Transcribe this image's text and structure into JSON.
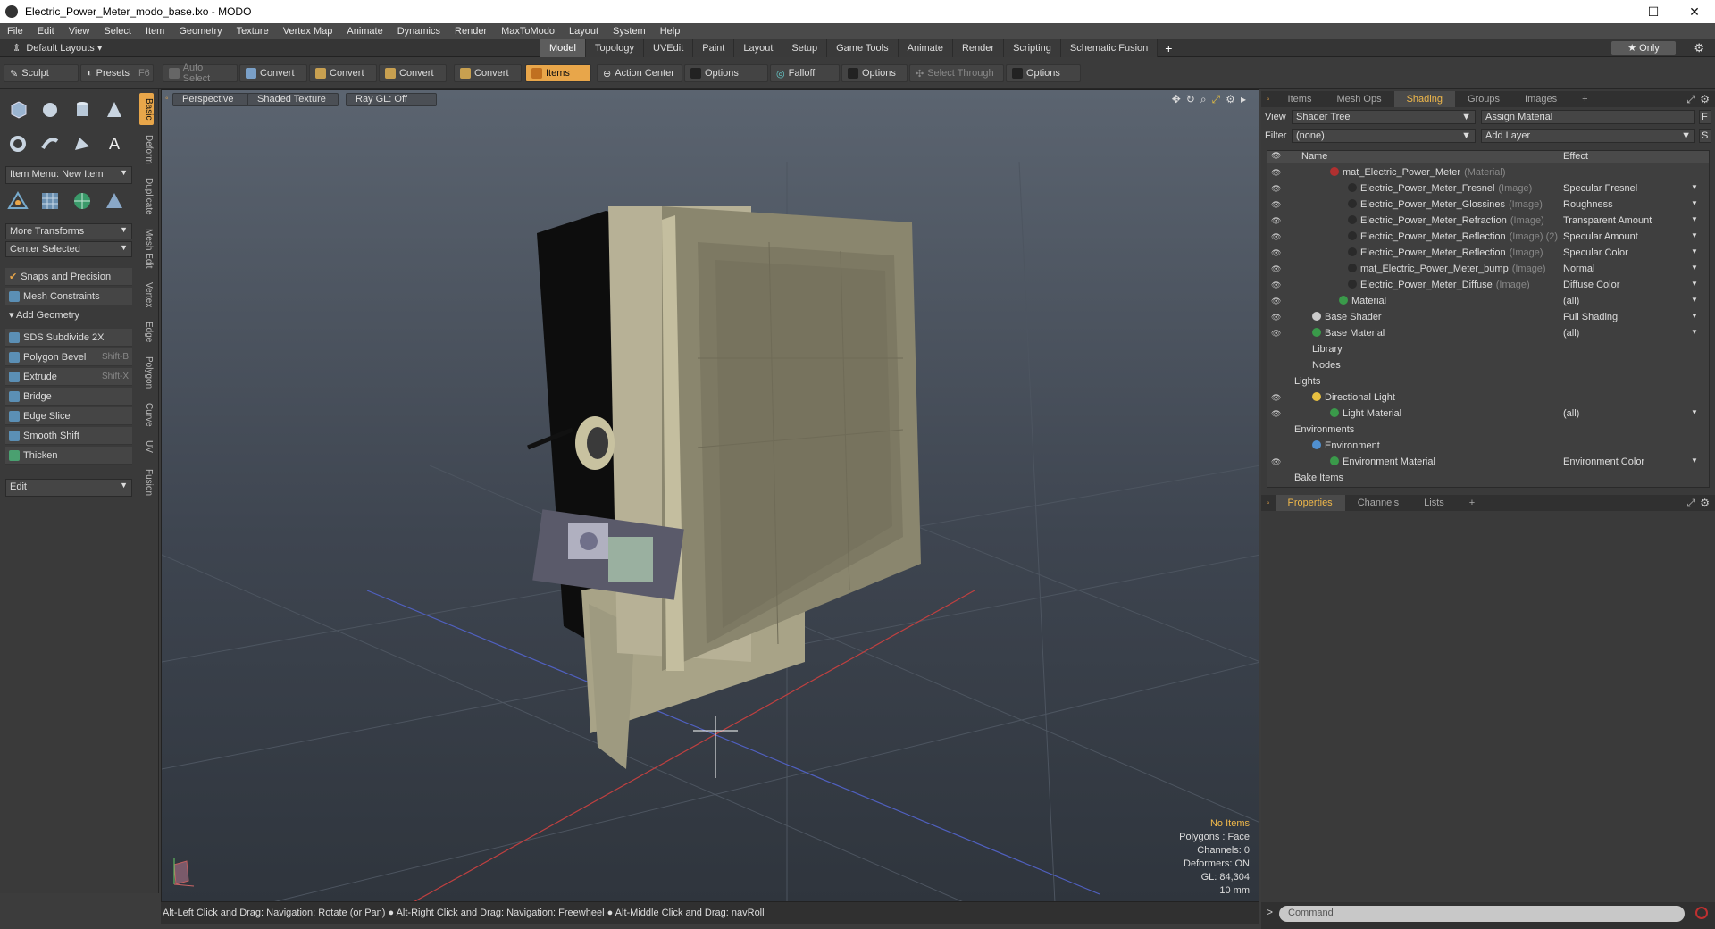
{
  "title": "Electric_Power_Meter_modo_base.lxo - MODO",
  "window_buttons": [
    "—",
    "☐",
    "✕"
  ],
  "menu": [
    "File",
    "Edit",
    "View",
    "Select",
    "Item",
    "Geometry",
    "Texture",
    "Vertex Map",
    "Animate",
    "Dynamics",
    "Render",
    "MaxToModo",
    "Layout",
    "System",
    "Help"
  ],
  "layout_selector": "Default Layouts",
  "layout_tabs": [
    "Model",
    "Topology",
    "UVEdit",
    "Paint",
    "Layout",
    "Setup",
    "Game Tools",
    "Animate",
    "Render",
    "Scripting",
    "Schematic Fusion"
  ],
  "active_layout_tab": "Model",
  "only_label": "Only",
  "toolbar": {
    "sculpt": "Sculpt",
    "presets": "Presets",
    "presets_key": "F6",
    "auto_select": "Auto Select",
    "convert1": "Convert",
    "convert2": "Convert",
    "convert3": "Convert",
    "convert4": "Convert",
    "items": "Items",
    "action_center": "Action Center",
    "options1": "Options",
    "falloff": "Falloff",
    "options2": "Options",
    "select_through": "Select Through",
    "options3": "Options"
  },
  "left": {
    "item_menu": "Item Menu: New Item",
    "more_transforms": "More Transforms",
    "center_selected": "Center Selected",
    "snaps": "Snaps and Precision",
    "mesh_constraints": "Mesh Constraints",
    "add_geometry": "Add Geometry",
    "tools": [
      {
        "label": "SDS Subdivide 2X",
        "key": ""
      },
      {
        "label": "Polygon Bevel",
        "key": "Shift-B"
      },
      {
        "label": "Extrude",
        "key": "Shift-X"
      },
      {
        "label": "Bridge",
        "key": ""
      },
      {
        "label": "Edge Slice",
        "key": ""
      },
      {
        "label": "Smooth Shift",
        "key": ""
      },
      {
        "label": "Thicken",
        "key": ""
      }
    ],
    "edit": "Edit",
    "vtabs": [
      "Basic",
      "Deform",
      "Duplicate",
      "Mesh Edit",
      "Vertex",
      "Edge",
      "Polygon",
      "Curve",
      "UV",
      "Fusion"
    ]
  },
  "viewport": {
    "perspective": "Perspective",
    "shading": "Shaded Texture",
    "raygl": "Ray GL: Off",
    "stats": {
      "no_items": "No Items",
      "polygons": "Polygons : Face",
      "channels": "Channels: 0",
      "deformers": "Deformers: ON",
      "gl": "GL: 84,304",
      "scale": "10 mm"
    }
  },
  "status_bar": "Alt-Left Click and Drag: Navigation: Rotate (or Pan) ● Alt-Right Click and Drag: Navigation: Freewheel ● Alt-Middle Click and Drag: navRoll",
  "right": {
    "tabs": [
      "Items",
      "Mesh Ops",
      "Shading",
      "Groups",
      "Images"
    ],
    "active_tab": "Shading",
    "view_label": "View",
    "view_value": "Shader Tree",
    "assign_material": "Assign Material",
    "filter_label": "Filter",
    "filter_value": "(none)",
    "add_layer": "Add Layer",
    "col_name": "Name",
    "col_effect": "Effect",
    "tree": [
      {
        "name": "mat_Electric_Power_Meter",
        "type": "(Material)",
        "effect": "",
        "indent": 5,
        "ball": "#b03030",
        "eye": true
      },
      {
        "name": "Electric_Power_Meter_Fresnel",
        "type": "(Image)",
        "effect": "Specular Fresnel",
        "indent": 7,
        "ball": "#2a2a2a",
        "eye": true
      },
      {
        "name": "Electric_Power_Meter_Glossines",
        "type": "(Image)",
        "effect": "Roughness",
        "indent": 7,
        "ball": "#2a2a2a",
        "eye": true
      },
      {
        "name": "Electric_Power_Meter_Refraction",
        "type": "(Image)",
        "effect": "Transparent Amount",
        "indent": 7,
        "ball": "#2a2a2a",
        "eye": true
      },
      {
        "name": "Electric_Power_Meter_Reflection",
        "type": "(Image) (2)",
        "effect": "Specular Amount",
        "indent": 7,
        "ball": "#2a2a2a",
        "eye": true
      },
      {
        "name": "Electric_Power_Meter_Reflection",
        "type": "(Image)",
        "effect": "Specular Color",
        "indent": 7,
        "ball": "#2a2a2a",
        "eye": true
      },
      {
        "name": "mat_Electric_Power_Meter_bump",
        "type": "(Image)",
        "effect": "Normal",
        "indent": 7,
        "ball": "#2a2a2a",
        "eye": true
      },
      {
        "name": "Electric_Power_Meter_Diffuse",
        "type": "(Image)",
        "effect": "Diffuse Color",
        "indent": 7,
        "ball": "#2a2a2a",
        "eye": true
      },
      {
        "name": "Material",
        "type": "",
        "effect": "(all)",
        "indent": 6,
        "ball": "#3a9a4a",
        "eye": true
      },
      {
        "name": "Base Shader",
        "type": "",
        "effect": "Full Shading",
        "indent": 3,
        "ball": "#cccccc",
        "eye": true
      },
      {
        "name": "Base Material",
        "type": "",
        "effect": "(all)",
        "indent": 3,
        "ball": "#3a9a4a",
        "eye": true
      },
      {
        "name": "Library",
        "type": "",
        "effect": "",
        "indent": 3,
        "ball": "",
        "eye": false
      },
      {
        "name": "Nodes",
        "type": "",
        "effect": "",
        "indent": 3,
        "ball": "",
        "eye": false
      },
      {
        "name": "Lights",
        "type": "",
        "effect": "",
        "indent": 1,
        "ball": "",
        "eye": false
      },
      {
        "name": "Directional Light",
        "type": "",
        "effect": "",
        "indent": 3,
        "ball": "#e8c040",
        "eye": true
      },
      {
        "name": "Light Material",
        "type": "",
        "effect": "(all)",
        "indent": 5,
        "ball": "#3a9a4a",
        "eye": true
      },
      {
        "name": "Environments",
        "type": "",
        "effect": "",
        "indent": 1,
        "ball": "",
        "eye": false
      },
      {
        "name": "Environment",
        "type": "",
        "effect": "",
        "indent": 3,
        "ball": "#5090d0",
        "eye": false
      },
      {
        "name": "Environment Material",
        "type": "",
        "effect": "Environment Color",
        "indent": 5,
        "ball": "#3a9a4a",
        "eye": true
      },
      {
        "name": "Bake Items",
        "type": "",
        "effect": "",
        "indent": 1,
        "ball": "",
        "eye": false
      }
    ],
    "bottom_tabs": [
      "Properties",
      "Channels",
      "Lists"
    ],
    "active_bottom_tab": "Properties",
    "command_placeholder": "Command"
  }
}
